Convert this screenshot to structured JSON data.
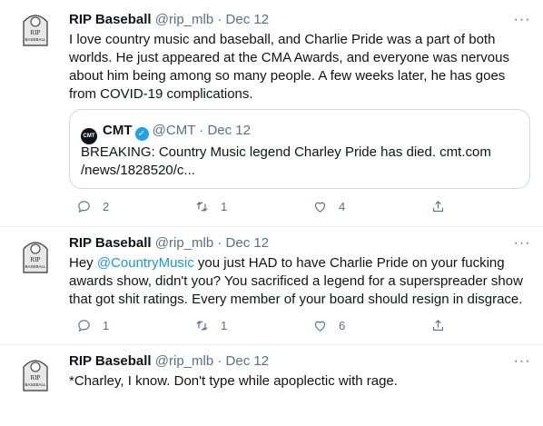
{
  "tweets": [
    {
      "name": "RIP Baseball",
      "handle": "@rip_mlb",
      "dot": "·",
      "date": "Dec 12",
      "text": "I love country music and baseball, and Charlie Pride was a part of both worlds. He just appeared at the CMA Awards, and everyone was nervous about him being among so many people. A few weeks later, he has goes from COVID-19 complications.",
      "quote": {
        "logo": "CMT",
        "name": "CMT",
        "handle": "@CMT",
        "dot": "·",
        "date": "Dec 12",
        "text": "BREAKING: Country Music legend Charley Pride has died. cmt.com /news/1828520/c..."
      },
      "replies": "2",
      "retweets": "1",
      "likes": "4"
    },
    {
      "name": "RIP Baseball",
      "handle": "@rip_mlb",
      "dot": "·",
      "date": "Dec 12",
      "text_pre": "Hey ",
      "mention": "@CountryMusic",
      "text_post": " you just HAD to have Charlie Pride on your fucking awards show, didn't you? You sacrificed a legend for a superspreader show that got shit ratings. Every member of your board should resign in disgrace.",
      "replies": "1",
      "retweets": "1",
      "likes": "6"
    },
    {
      "name": "RIP Baseball",
      "handle": "@rip_mlb",
      "dot": "·",
      "date": "Dec 12",
      "text": "*Charley, I know. Don't type while apoplectic with rage."
    }
  ],
  "more_glyph": "···",
  "avatar_label": "RIP BASEBALL",
  "colors": {
    "accent": "#1b95e0",
    "secondary": "#5b7083",
    "text": "#0f1419"
  },
  "icons": [
    "reply-icon",
    "retweet-icon",
    "like-icon",
    "share-icon",
    "more-icon",
    "verified-badge-icon"
  ]
}
